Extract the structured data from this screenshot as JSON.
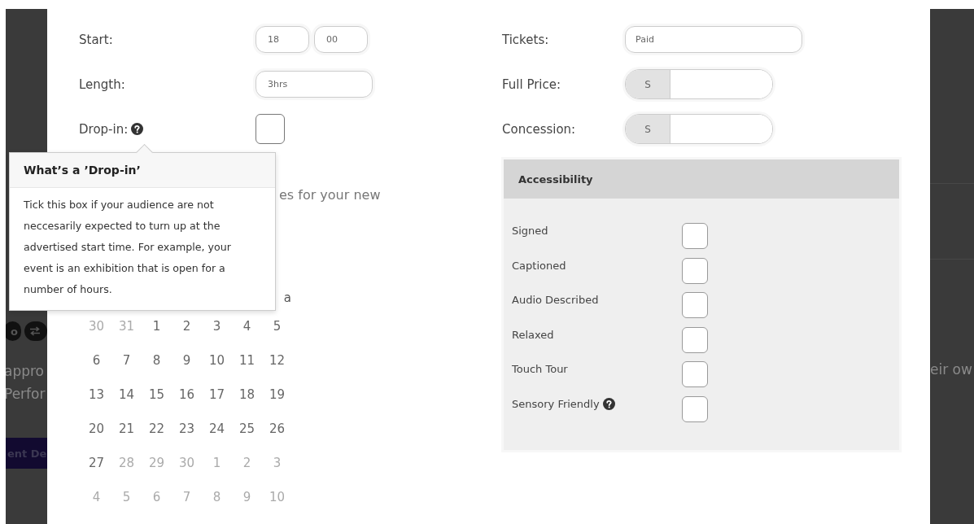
{
  "background_page": {
    "left": {
      "pill_text": "o",
      "texts": [
        "appro",
        "Perfor"
      ],
      "button": "ent De"
    },
    "right": {
      "text": "eir ow"
    }
  },
  "form": {
    "start": {
      "label": "Start:",
      "hour": "18",
      "minute": "00"
    },
    "length": {
      "label": "Length:",
      "value": "3hrs"
    },
    "drop_in": {
      "label": "Drop-in:",
      "checked": false
    },
    "intro_fragment": "es for your new",
    "calendar": {
      "header_fragment": "a",
      "weeks": [
        [
          {
            "day": "30",
            "muted": true
          },
          {
            "day": "31",
            "muted": true
          },
          {
            "day": "1",
            "muted": false
          },
          {
            "day": "2",
            "muted": false
          },
          {
            "day": "3",
            "muted": false
          },
          {
            "day": "4",
            "muted": false
          },
          {
            "day": "5",
            "muted": false
          }
        ],
        [
          {
            "day": "6",
            "muted": false
          },
          {
            "day": "7",
            "muted": false
          },
          {
            "day": "8",
            "muted": false
          },
          {
            "day": "9",
            "muted": false
          },
          {
            "day": "10",
            "muted": false
          },
          {
            "day": "11",
            "muted": false
          },
          {
            "day": "12",
            "muted": false
          }
        ],
        [
          {
            "day": "13",
            "muted": false
          },
          {
            "day": "14",
            "muted": false
          },
          {
            "day": "15",
            "muted": false
          },
          {
            "day": "16",
            "muted": false
          },
          {
            "day": "17",
            "muted": false
          },
          {
            "day": "18",
            "muted": false
          },
          {
            "day": "19",
            "muted": false
          }
        ],
        [
          {
            "day": "20",
            "muted": false
          },
          {
            "day": "21",
            "muted": false
          },
          {
            "day": "22",
            "muted": false
          },
          {
            "day": "23",
            "muted": false
          },
          {
            "day": "24",
            "muted": false
          },
          {
            "day": "25",
            "muted": false
          },
          {
            "day": "26",
            "muted": false
          }
        ],
        [
          {
            "day": "27",
            "muted": false
          },
          {
            "day": "28",
            "muted": true
          },
          {
            "day": "29",
            "muted": true
          },
          {
            "day": "30",
            "muted": true
          },
          {
            "day": "1",
            "muted": true
          },
          {
            "day": "2",
            "muted": true
          },
          {
            "day": "3",
            "muted": true
          }
        ],
        [
          {
            "day": "4",
            "muted": true
          },
          {
            "day": "5",
            "muted": true
          },
          {
            "day": "6",
            "muted": true
          },
          {
            "day": "7",
            "muted": true
          },
          {
            "day": "8",
            "muted": true
          },
          {
            "day": "9",
            "muted": true
          },
          {
            "day": "10",
            "muted": true
          }
        ]
      ]
    },
    "tickets": {
      "label": "Tickets:",
      "value": "Paid"
    },
    "prices": [
      {
        "label": "Full Price:",
        "prefix": "S"
      },
      {
        "label": "Concession:",
        "prefix": "S"
      }
    ],
    "accessibility": {
      "title": "Accessibility",
      "items": [
        {
          "label": "Signed",
          "checked": false,
          "help": false
        },
        {
          "label": "Captioned",
          "checked": false,
          "help": false
        },
        {
          "label": "Audio Described",
          "checked": false,
          "help": false
        },
        {
          "label": "Relaxed",
          "checked": false,
          "help": false
        },
        {
          "label": "Touch Tour",
          "checked": false,
          "help": false
        },
        {
          "label": "Sensory Friendly",
          "checked": false,
          "help": true
        }
      ]
    }
  },
  "tooltip": {
    "title": "What’s a ’Drop-in’",
    "text": "Tick this box if your audience are not neccesarily expected to turn up at the advertised start time. For example, your event is an exhibition that is open for a number of hours."
  }
}
